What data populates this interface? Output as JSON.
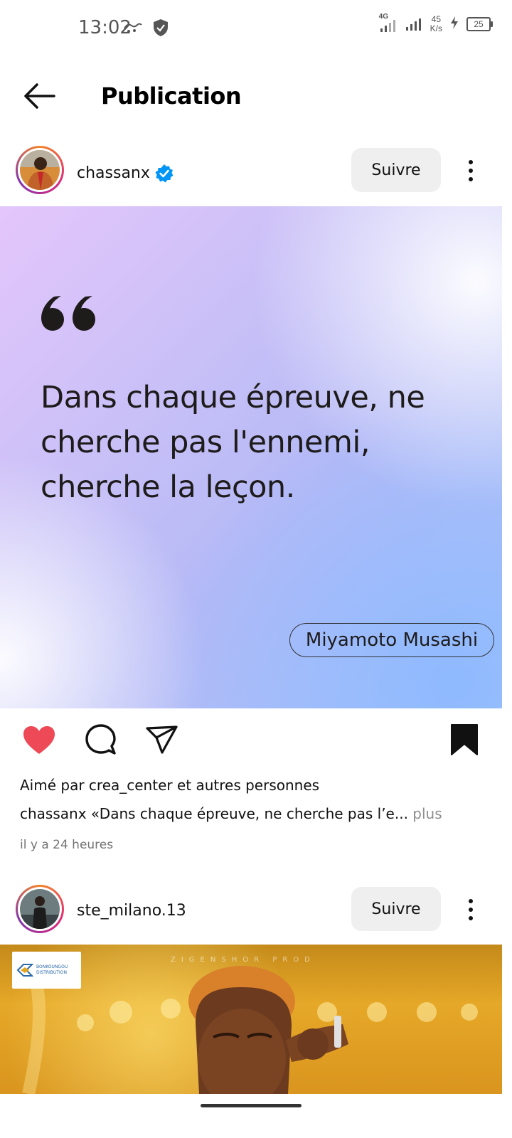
{
  "status_bar": {
    "time": "13:02",
    "network_type": "4G",
    "speed_value": "45",
    "speed_unit": "K/s",
    "battery": "25"
  },
  "header": {
    "title": "Publication"
  },
  "post1": {
    "username": "chassanx",
    "follow_label": "Suivre",
    "quote_text": "Dans chaque épreuve, ne cherche pas l'ennemi, cherche la leçon.",
    "author": "Miyamoto Musashi",
    "likes_text": "Aimé par crea_center et autres personnes",
    "caption_user": "chassanx",
    "caption_text": " «Dans chaque épreuve, ne cherche pas l’e...",
    "caption_more": " plus",
    "timestamp": "il y a 24 heures",
    "liked": true,
    "saved": true
  },
  "post2": {
    "username": "ste_milano.13",
    "follow_label": "Suivre",
    "brand_name": "BONKOUNGOU",
    "brand_sub": "DISTRIBUTION",
    "prod_label": "ZIGENSHOR PROD"
  },
  "colors": {
    "like_red": "#ed4956",
    "verified_blue": "#0095f6",
    "follow_bg": "#efefef"
  }
}
